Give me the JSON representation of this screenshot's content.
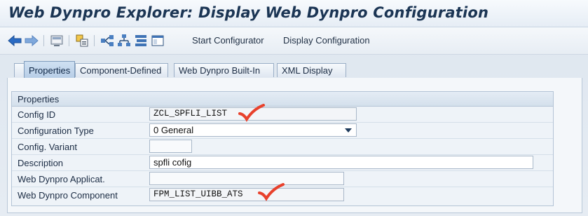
{
  "title": "Web Dynpro Explorer: Display Web Dynpro Configuration",
  "toolbar": {
    "icons": [
      "back-arrow-icon",
      "forward-arrow-icon",
      "screen-icon",
      "object-list-icon",
      "navigation-icon",
      "hierarchy-icon",
      "structure-icon",
      "window-icon"
    ],
    "start_configurator": "Start Configurator",
    "display_configuration": "Display Configuration"
  },
  "tabs": [
    {
      "label": "Properties",
      "active": true
    },
    {
      "label": "Component-Defined",
      "active": false
    },
    {
      "label": "Web Dynpro Built-In",
      "active": false
    },
    {
      "label": "XML Display",
      "active": false
    }
  ],
  "properties": {
    "group_title": "Properties",
    "fields": [
      {
        "label": "Config ID",
        "value": "ZCL_SPFLI_LIST"
      },
      {
        "label": "Configuration Type",
        "value": "0 General"
      },
      {
        "label": "Config. Variant",
        "value": ""
      },
      {
        "label": "Description",
        "value": "spfli cofig"
      },
      {
        "label": "Web Dynpro Applicat.",
        "value": ""
      },
      {
        "label": "Web Dynpro Component",
        "value": "FPM_LIST_UIBB_ATS"
      }
    ]
  },
  "colors": {
    "title": "#1b3554",
    "active_tab": "#b6cde6",
    "checkmark": "#e8412c"
  }
}
